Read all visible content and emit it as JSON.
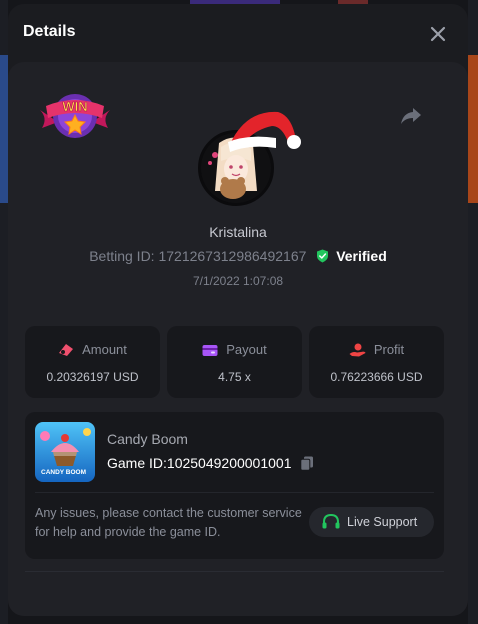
{
  "modal": {
    "title": "Details"
  },
  "icons": {
    "close": "close-icon",
    "share": "share-arrow-icon",
    "win_badge": "win-star-badge-icon",
    "verified": "shield-check-icon",
    "amount": "bet-chip-icon",
    "payout": "wallet-icon",
    "profit": "hand-coin-icon",
    "copy": "copy-icon",
    "support": "headset-icon"
  },
  "win_badge_text": "WIN",
  "player": {
    "username": "Kristalina",
    "betting_id_label": "Betting ID: 1721267312986492167",
    "verified_label": "Verified",
    "timestamp": "7/1/2022 1:07:08"
  },
  "stats": [
    {
      "label": "Amount",
      "value": "0.20326197 USD"
    },
    {
      "label": "Payout",
      "value": "4.75 x"
    },
    {
      "label": "Profit",
      "value": "0.76223666 USD"
    }
  ],
  "game": {
    "name": "Candy Boom",
    "id_label": "Game ID:1025049200001001",
    "thumb_title": "CANDY BOOM"
  },
  "help": {
    "text": "Any issues, please contact the customer service for help and provide the game ID.",
    "live_support_label": "Live Support"
  },
  "colors": {
    "verified": "#22c55e",
    "amount_icon": "#f0506e",
    "payout_icon": "#a855f7",
    "profit_icon": "#ef4444",
    "support_icon": "#22c55e"
  }
}
